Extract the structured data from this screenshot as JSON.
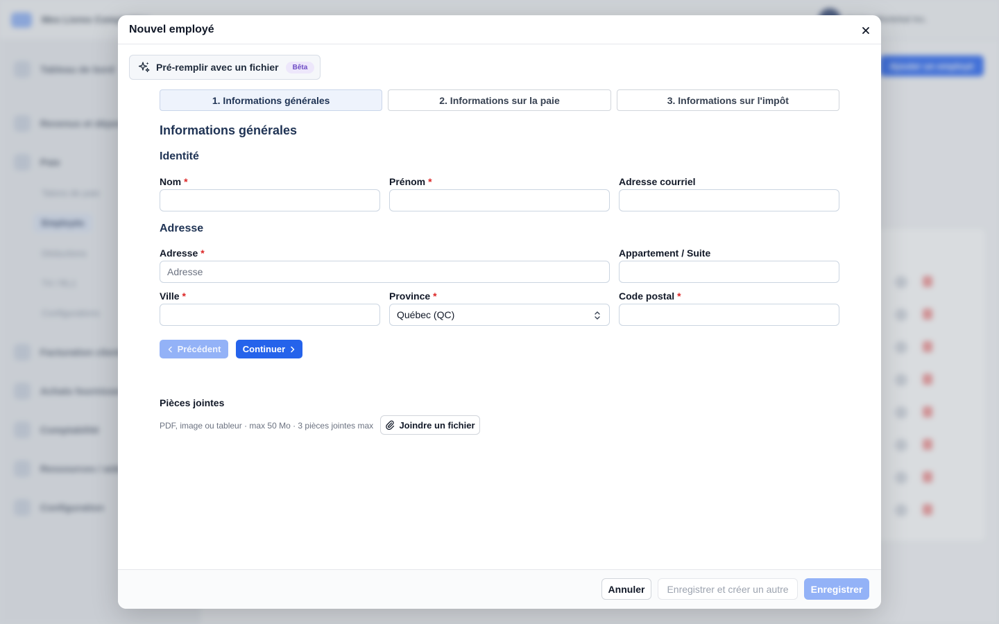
{
  "background": {
    "app_name": "Mes Livres Comptables",
    "account_name": "Ventes Montréal Inc.",
    "nav": [
      {
        "label": "Tableau de bord"
      },
      {
        "label": "Revenus et dépenses"
      },
      {
        "label": "Paie"
      },
      {
        "label": "Facturation clients"
      },
      {
        "label": "Achats fournisseurs"
      },
      {
        "label": "Comptabilité"
      },
      {
        "label": "Ressources / aide"
      },
      {
        "label": "Configuration"
      }
    ],
    "pay_subnav": [
      {
        "label": "Talons de paie"
      },
      {
        "label": "Employés"
      },
      {
        "label": "Déductions"
      },
      {
        "label": "T4 / RL1"
      },
      {
        "label": "Configurations"
      }
    ],
    "add_employee_button": "Ajouter un employé"
  },
  "modal": {
    "title": "Nouvel employé",
    "prefill": {
      "label": "Pré-remplir avec un fichier",
      "badge": "Bêta"
    },
    "steps": [
      {
        "label": "1. Informations générales",
        "active": true
      },
      {
        "label": "2. Informations sur la paie",
        "active": false
      },
      {
        "label": "3. Informations sur l'impôt",
        "active": false
      }
    ],
    "section_title": "Informations générales",
    "identity": {
      "title": "Identité",
      "last_name": {
        "label": "Nom",
        "required_mark": "*",
        "value": ""
      },
      "first_name": {
        "label": "Prénom",
        "required_mark": "*",
        "value": ""
      },
      "email": {
        "label": "Adresse courriel",
        "value": ""
      }
    },
    "address": {
      "title": "Adresse",
      "street": {
        "label": "Adresse",
        "required_mark": "*",
        "placeholder": "Adresse",
        "value": ""
      },
      "suite": {
        "label": "Appartement / Suite",
        "value": ""
      },
      "city": {
        "label": "Ville",
        "required_mark": "*",
        "value": ""
      },
      "province": {
        "label": "Province",
        "required_mark": "*",
        "selected": "Québec (QC)"
      },
      "postal_code": {
        "label": "Code postal",
        "required_mark": "*",
        "value": ""
      }
    },
    "nav_buttons": {
      "previous": "Précédent",
      "next": "Continuer"
    },
    "attachments": {
      "title": "Pièces jointes",
      "help": "PDF, image ou tableur · max 50 Mo · 3 pièces jointes max",
      "button": "Joindre un fichier"
    },
    "footer": {
      "cancel": "Annuler",
      "save_and_new": "Enregistrer et créer un autre",
      "save": "Enregistrer"
    }
  },
  "colors": {
    "primary": "#2563eb",
    "primary_disabled": "#93b2f7",
    "heading": "#1f3354",
    "required": "#dc2626",
    "beta_badge": "#6d4bc4"
  }
}
